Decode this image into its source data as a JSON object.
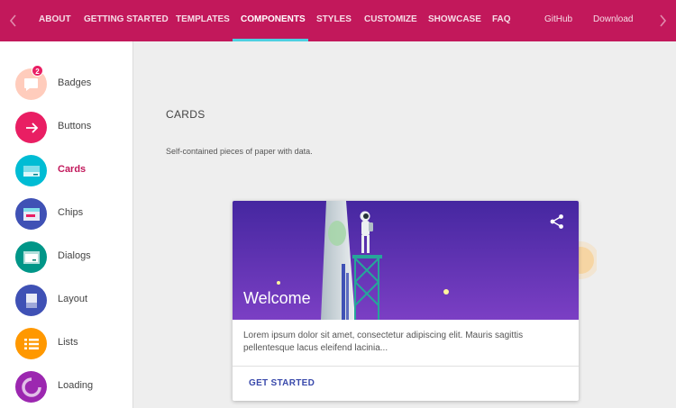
{
  "nav": {
    "items": [
      {
        "label": "ABOUT"
      },
      {
        "label": "GETTING STARTED"
      },
      {
        "label": "TEMPLATES"
      },
      {
        "label": "COMPONENTS",
        "active": true
      },
      {
        "label": "STYLES"
      },
      {
        "label": "CUSTOMIZE"
      },
      {
        "label": "SHOWCASE"
      },
      {
        "label": "FAQ"
      }
    ],
    "github": "GitHub",
    "download": "Download",
    "accent_color": "#c2185b",
    "underline_color": "#4dd0e1"
  },
  "sidebar": {
    "items": [
      {
        "label": "Badges",
        "icon": "badge-icon",
        "color": "#ffccbc",
        "badge": "2"
      },
      {
        "label": "Buttons",
        "icon": "arrow-right-icon",
        "color": "#e91e63"
      },
      {
        "label": "Cards",
        "icon": "card-icon",
        "color": "#00bcd4",
        "active": true
      },
      {
        "label": "Chips",
        "icon": "chip-icon",
        "color": "#3f51b5"
      },
      {
        "label": "Dialogs",
        "icon": "dialog-icon",
        "color": "#009688"
      },
      {
        "label": "Layout",
        "icon": "layout-icon",
        "color": "#3f51b5"
      },
      {
        "label": "Lists",
        "icon": "list-icon",
        "color": "#ff9800"
      },
      {
        "label": "Loading",
        "icon": "spinner-icon",
        "color": "#9c27b0"
      }
    ]
  },
  "main": {
    "title": "CARDS",
    "description": "Self-contained pieces of paper with data."
  },
  "card": {
    "title": "Welcome",
    "text": "Lorem ipsum dolor sit amet, consectetur adipiscing elit. Mauris sagittis pellentesque lacus eleifend lacinia...",
    "action": "GET STARTED",
    "share_icon": "share-icon"
  }
}
